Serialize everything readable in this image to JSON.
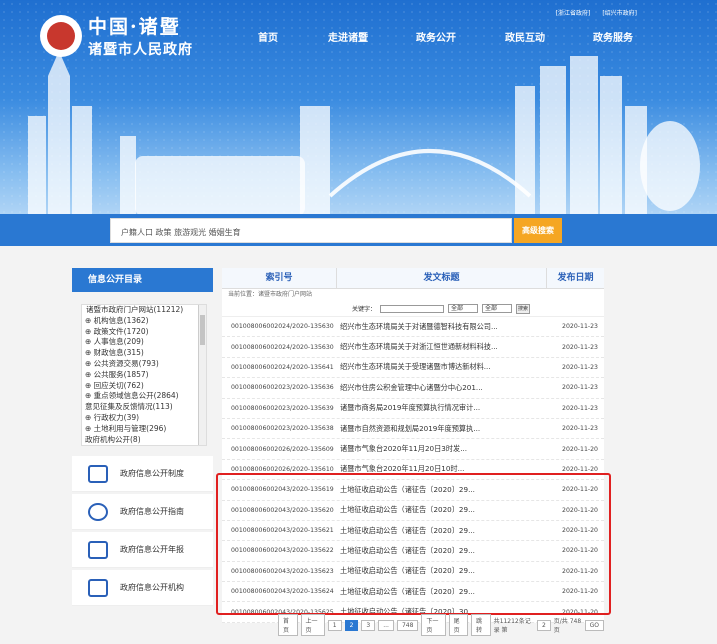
{
  "header": {
    "top_links": [
      "[浙江省政府]",
      "[绍兴市政府]"
    ],
    "logo_line1": "中国·诸暨",
    "logo_line2": "诸暨市人民政府",
    "nav": [
      "首页",
      "走进诸暨",
      "政务公开",
      "政民互动",
      "政务服务"
    ]
  },
  "search": {
    "hot_words": "户籍人口  政策  旅游观光  婚姻生育",
    "button": "高级搜索"
  },
  "sidebar": {
    "title": "信息公开目录",
    "tree": [
      "诸暨市政府门户网站(11212)",
      "⊕ 机构信息(1362)",
      "⊕ 政策文件(1720)",
      "⊕ 人事信息(209)",
      "⊕ 财政信息(315)",
      "⊕ 公共资源交易(793)",
      "⊕ 公共服务(1857)",
      "⊕ 回应关切(762)",
      "⊕ 重点领域信息公开(2864)",
      "  意见征集及反馈情况(113)",
      "⊕ 行政权力(39)",
      "⊕ 土地利用与管理(296)",
      "  政府机构公开(8)"
    ],
    "menu": [
      {
        "label": "政府信息公开制度",
        "icon": "document-icon"
      },
      {
        "label": "政府信息公开指南",
        "icon": "compass-icon"
      },
      {
        "label": "政府信息公开年报",
        "icon": "report-icon"
      },
      {
        "label": "政府信息公开机构",
        "icon": "institution-icon"
      }
    ]
  },
  "table": {
    "headers": [
      "索引号",
      "发文标题",
      "发布日期"
    ],
    "breadcrumb": "当前位置：诸暨市政府门户网站",
    "filter_keyword_label": "关键字：",
    "filter_select1": "全部",
    "filter_select2": "全部",
    "filter_button": "搜索",
    "rows": [
      {
        "index": "00100800600202​4/2020-135630",
        "title": "绍兴市生态环境局关于对诸暨德智科技有限公司...",
        "date": "2020-11-23"
      },
      {
        "index": "001008006002024/2020-135630",
        "title": "绍兴市生态环境局关于对浙江恒世通新材料科技...",
        "date": "2020-11-23"
      },
      {
        "index": "001008006002024/2020-135641",
        "title": "绍兴市生态环境局关于受理诸暨市博达新材料...",
        "date": "2020-11-23"
      },
      {
        "index": "001008006002023/2020-135636",
        "title": "绍兴市住房公积金管理中心诸暨分中心201...",
        "date": "2020-11-23"
      },
      {
        "index": "001008006002023/2020-135639",
        "title": "诸暨市商务局2019年度预算执行情况审计...",
        "date": "2020-11-23"
      },
      {
        "index": "001008006002023/2020-135638",
        "title": "诸暨市自然资源和规划局2019年度预算执...",
        "date": "2020-11-23"
      },
      {
        "index": "001008006002026/2020-135609",
        "title": "诸暨市气象台2020年11月20日3时发...",
        "date": "2020-11-20"
      },
      {
        "index": "001008006002026/2020-135610",
        "title": "诸暨市气象台2020年11月20日10时...",
        "date": "2020-11-20"
      },
      {
        "index": "001008006002043/2020-135619",
        "title": "土地征收启动公告（诸征告〔2020〕29...",
        "date": "2020-11-20"
      },
      {
        "index": "001008006002043/2020-135620",
        "title": "土地征收启动公告（诸征告〔2020〕29...",
        "date": "2020-11-20"
      },
      {
        "index": "001008006002043/2020-135621",
        "title": "土地征收启动公告（诸征告〔2020〕29...",
        "date": "2020-11-20"
      },
      {
        "index": "001008006002043/2020-135622",
        "title": "土地征收启动公告（诸征告〔2020〕29...",
        "date": "2020-11-20"
      },
      {
        "index": "001008006002043/2020-135623",
        "title": "土地征收启动公告（诸征告〔2020〕29...",
        "date": "2020-11-20"
      },
      {
        "index": "001008006002043/2020-135624",
        "title": "土地征收启动公告（诸征告〔2020〕29...",
        "date": "2020-11-20"
      },
      {
        "index": "001008006002043/2020-135625",
        "title": "土地征收启动公告（诸征告〔2020〕30...",
        "date": "2020-11-20"
      }
    ]
  },
  "pager": {
    "buttons": [
      "首页",
      "上一页",
      "1",
      "2",
      "3",
      "...",
      "748",
      "下一页",
      "尾页",
      "跳转"
    ],
    "current": "2",
    "info": "共11212条记录 第",
    "page_input": "2",
    "info2": "页/共 748 页",
    "go": "GO"
  },
  "colors": {
    "accent": "#2a78d2",
    "highlight": "#e02020",
    "button": "#f5a623"
  }
}
